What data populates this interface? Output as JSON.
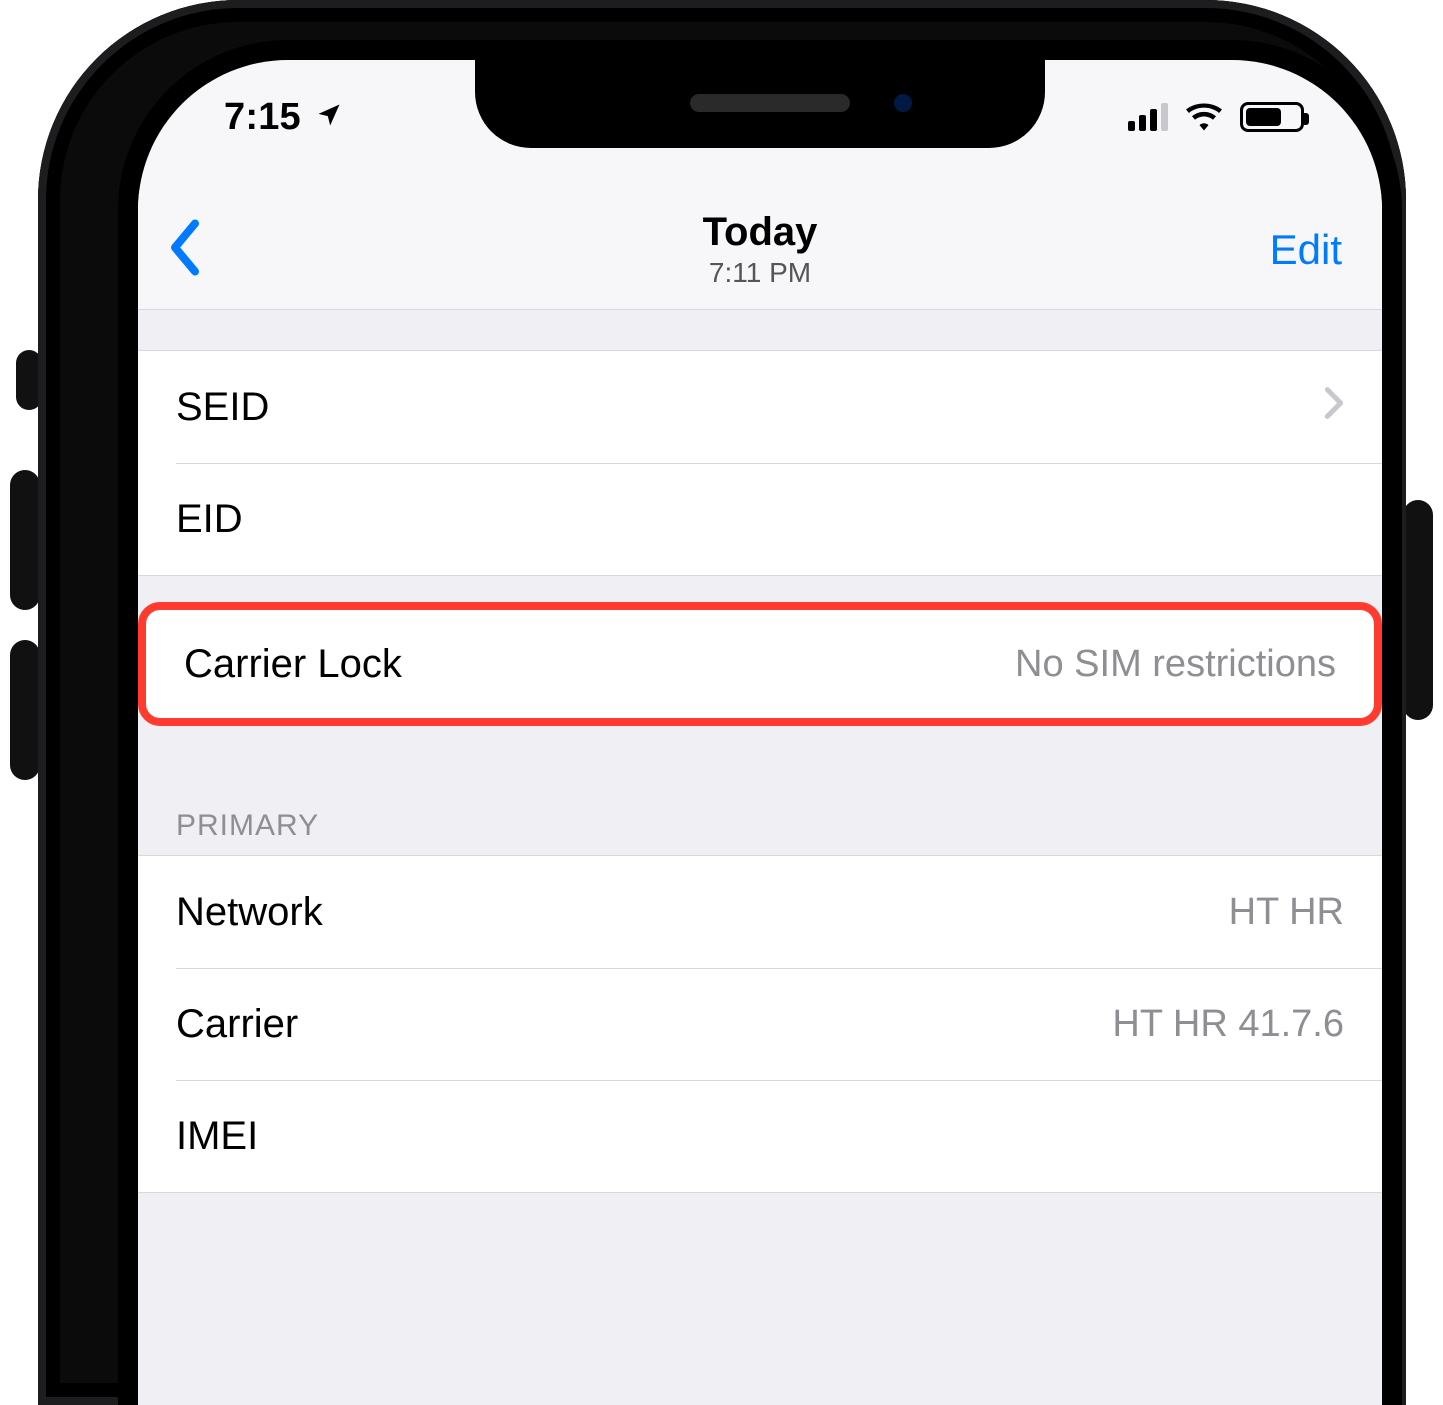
{
  "status_bar": {
    "time": "7:15",
    "location_icon": "location-arrow-icon",
    "cellular_bars_active": 3,
    "wifi_icon": "wifi-icon",
    "battery_percent_approx": 60
  },
  "navbar": {
    "back_icon": "chevron-left-icon",
    "title": "Today",
    "subtitle": "7:11 PM",
    "edit_label": "Edit"
  },
  "group1": {
    "rows": [
      {
        "label": "SEID",
        "value": "",
        "disclosure": true
      },
      {
        "label": "EID",
        "value": "",
        "disclosure": false
      }
    ]
  },
  "highlight_row": {
    "label": "Carrier Lock",
    "value": "No SIM restrictions",
    "highlight_color": "#ff3b2f"
  },
  "section_primary": {
    "header": "PRIMARY",
    "rows": [
      {
        "label": "Network",
        "value": "HT HR"
      },
      {
        "label": "Carrier",
        "value": "HT HR 41.7.6"
      },
      {
        "label": "IMEI",
        "value": ""
      }
    ]
  },
  "colors": {
    "ios_blue": "#007aff",
    "ios_gray_text": "#8e8e93",
    "separator": "#d8d8dc",
    "grouped_bg": "#efeff4"
  }
}
